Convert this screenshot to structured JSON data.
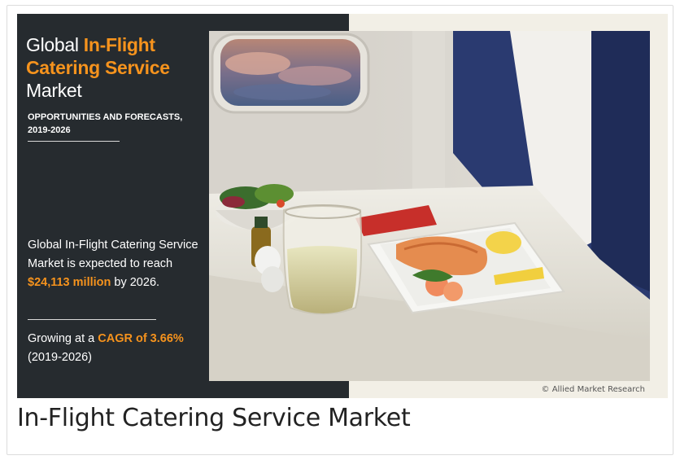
{
  "infographic": {
    "title_line1_plain": "Global ",
    "title_line1_accent": "In-Flight",
    "title_line2_accent": "Catering Service",
    "title_line3": "Market",
    "subtitle_line1": "OPPORTUNITIES AND FORECASTS,",
    "subtitle_line2": "2019-2026",
    "body_prefix": "Global In-Flight Catering Service Market is expected to reach ",
    "body_value": "$24,113 million",
    "body_suffix": " by 2026.",
    "growth_prefix": "Growing at a ",
    "growth_value": "CAGR of 3.66%",
    "growth_period": "(2019-2026)",
    "credit": "© Allied Market Research"
  },
  "caption": "In-Flight Catering Service Market",
  "colors": {
    "accent": "#f6931d",
    "panel": "#262b2f"
  }
}
